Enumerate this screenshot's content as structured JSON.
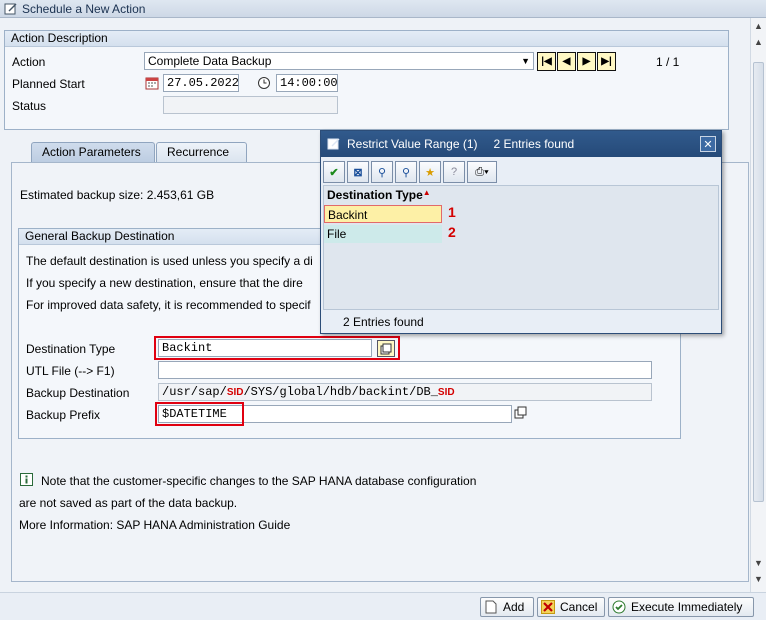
{
  "window": {
    "title": "Schedule a New Action"
  },
  "action_description": {
    "title": "Action Description",
    "action_label": "Action",
    "action_value": "Complete Data Backup",
    "planned_start_label": "Planned Start",
    "date": "27.05.2022",
    "time": "14:00:00",
    "status_label": "Status",
    "status_value": "",
    "paging": "1 / 1"
  },
  "tabs": [
    {
      "label": "Action Parameters",
      "active": true
    },
    {
      "label": "Recurrence",
      "active": false
    }
  ],
  "estimated": "Estimated backup size: 2.453,61 GB",
  "general": {
    "title": "General Backup Destination",
    "line1": "The default destination is used unless you specify a di",
    "line2": "If you specify a new destination, ensure that the dire",
    "line3": "For improved data safety, it is recommended to specif",
    "dest_type_label": "Destination Type",
    "dest_type_value": "Backint",
    "utl_label": "UTL File (--> F1)",
    "utl_value": "",
    "backup_dest_label": "Backup Destination",
    "backup_dest_p1": "/usr/sap/",
    "backup_dest_sid1": "SID",
    "backup_dest_p2": "/SYS/global/hdb/backint/DB_",
    "backup_dest_sid2": "SID",
    "prefix_label": "Backup Prefix",
    "prefix_value": "$DATETIME"
  },
  "info": {
    "line1": "Note that the customer-specific changes to the SAP HANA database configuration",
    "line2": "are not saved as part of the data backup.",
    "line3": "More Information: SAP HANA Administration Guide"
  },
  "buttons": {
    "add": "Add",
    "cancel": "Cancel",
    "execute": "Execute Immediately"
  },
  "popup": {
    "title": "Restrict Value Range (1)",
    "found_title": "2 Entries found",
    "column": "Destination Type",
    "rows": [
      "Backint",
      "File"
    ],
    "badges": [
      "1",
      "2"
    ],
    "status": "2 Entries found"
  },
  "colors": {
    "accent_red": "#e00010",
    "popup_title": "#2b5285",
    "selected_row": "#fdf0a6",
    "alt_row": "#cdeaea"
  }
}
